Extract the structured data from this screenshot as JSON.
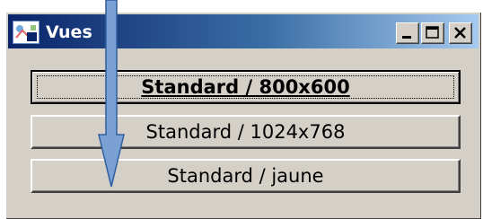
{
  "window": {
    "title": "Vues",
    "app_icon": "app-logo-icon",
    "controls": [
      "minimize-icon",
      "maximize-icon",
      "close-icon"
    ]
  },
  "buttons": [
    {
      "label": "Standard / 800x600",
      "default": true
    },
    {
      "label": "Standard / 1024x768",
      "default": false
    },
    {
      "label": "Standard / jaune",
      "default": false
    }
  ],
  "overlay": {
    "arrow_icon": "down-arrow-icon",
    "arrow_color": "#7aa0d4"
  }
}
